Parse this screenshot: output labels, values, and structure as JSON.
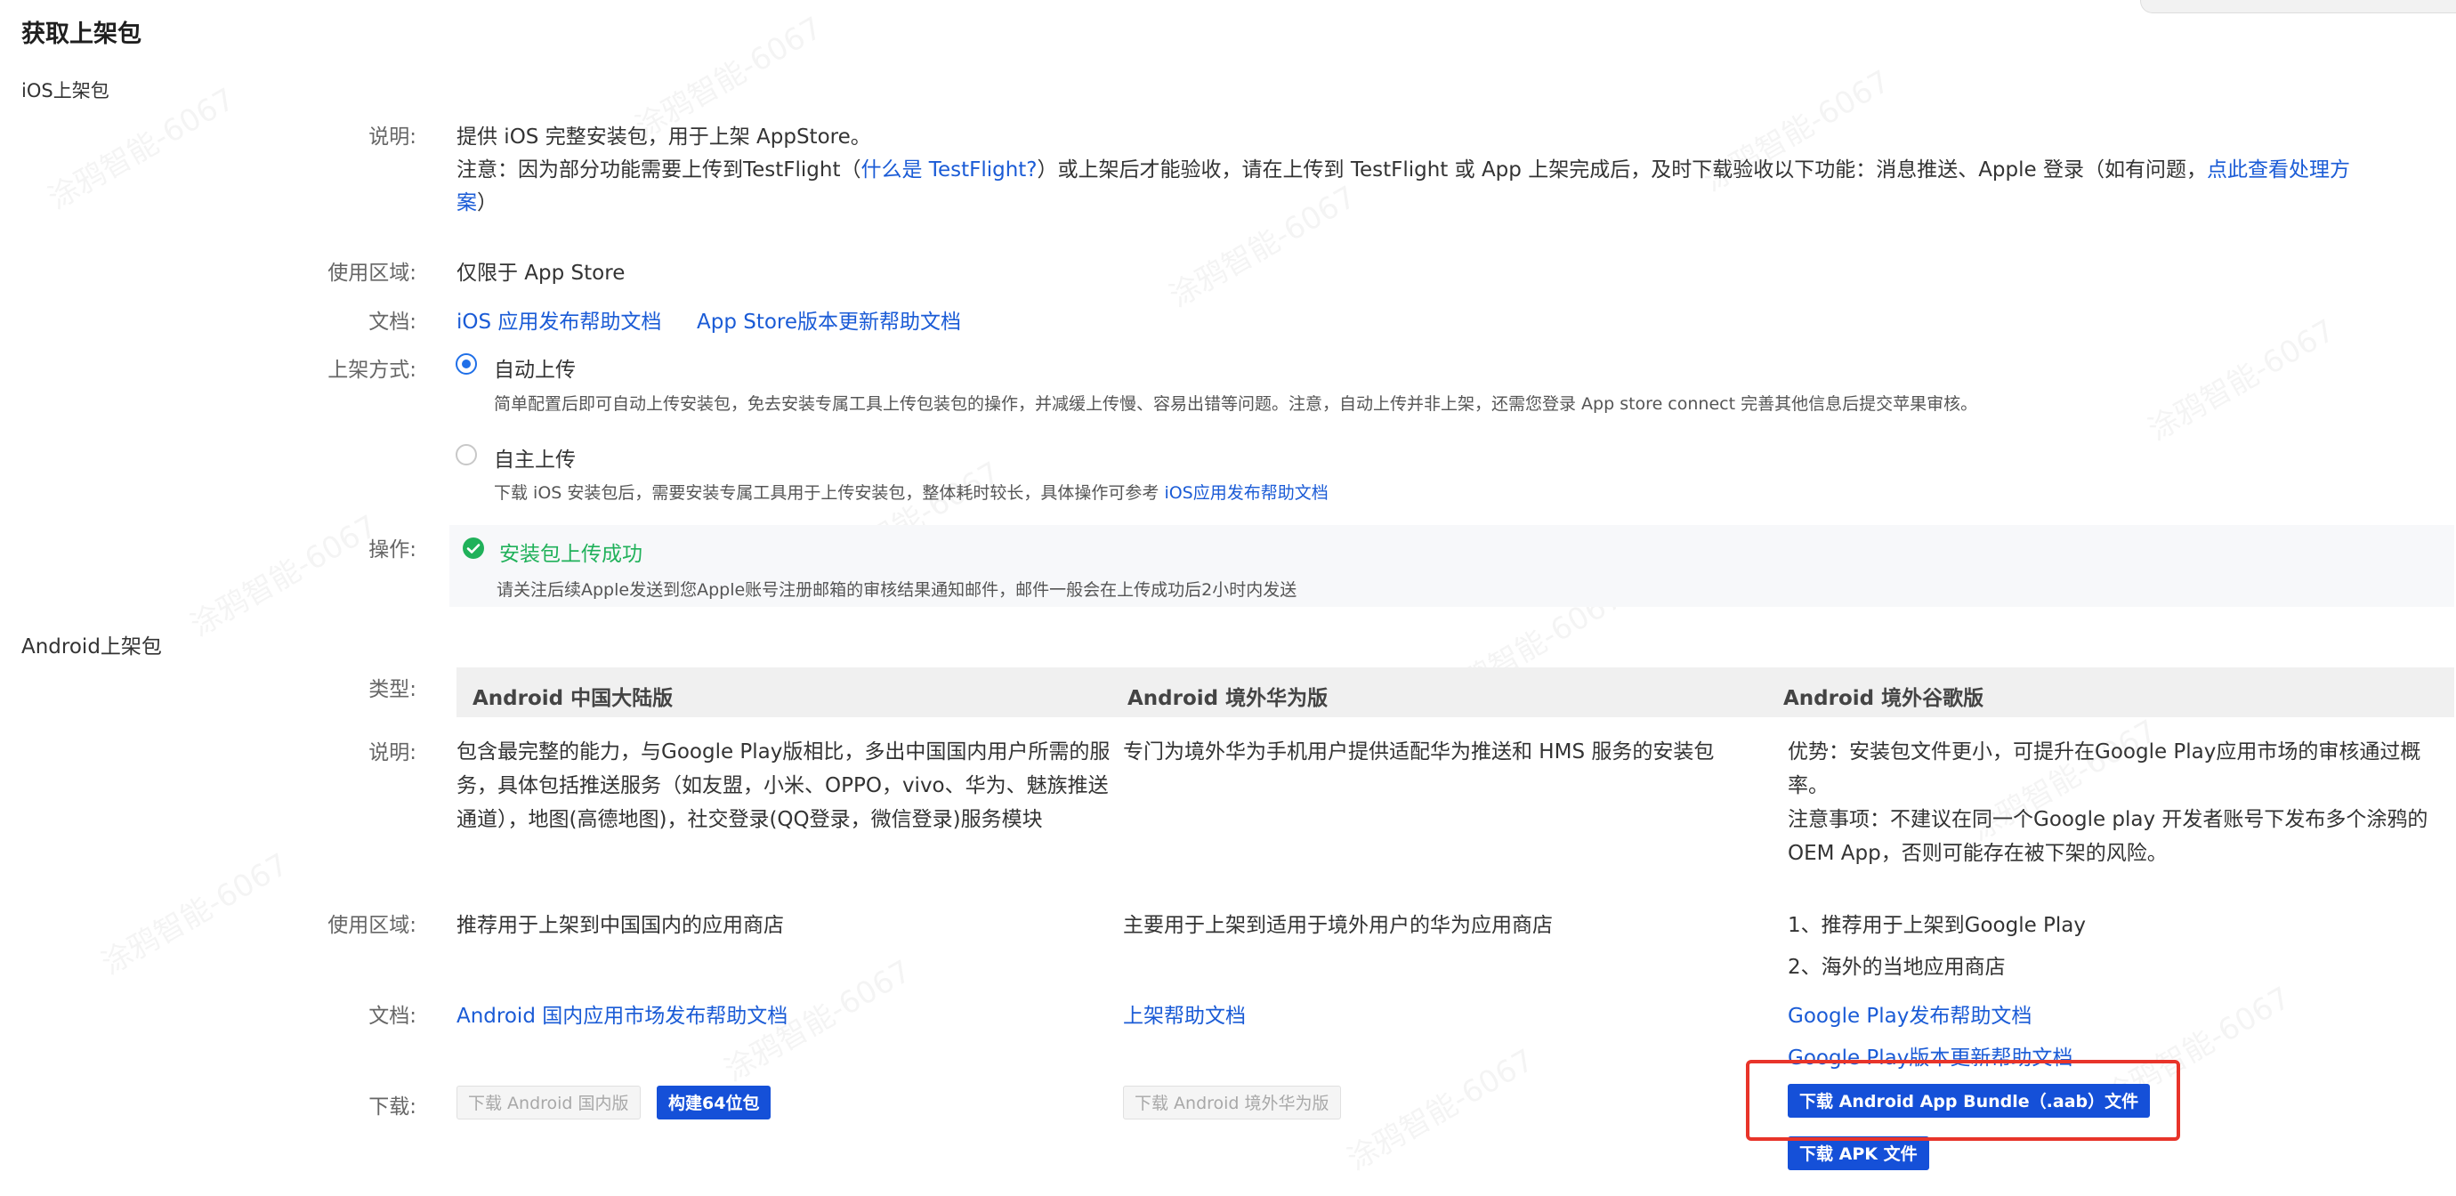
{
  "page": {
    "title": "获取上架包"
  },
  "ios": {
    "section_title": "iOS上架包",
    "desc_label": "说明:",
    "desc_line1": "提供 iOS 完整安装包，用于上架 AppStore。",
    "desc_note_prefix": "注意：因为部分功能需要上传到TestFlight（",
    "desc_note_link1": "什么是 TestFlight?",
    "desc_note_middle": "）或上架后才能验收，请在上传到 TestFlight 或 App 上架完成后，及时下载验收以下功能：消息推送、Apple 登录（如有问题，",
    "desc_note_link2a": "点此查看处理方",
    "desc_note_link2b": "案",
    "desc_note_suffix": "）",
    "region_label": "使用区域:",
    "region_value": "仅限于 App Store",
    "docs_label": "文档:",
    "doc_link1": "iOS 应用发布帮助文档",
    "doc_link2": "App Store版本更新帮助文档",
    "method_label": "上架方式:",
    "auto_upload_label": "自动上传",
    "auto_upload_desc": "简单配置后即可自动上传安装包，免去安装专属工具上传包装包的操作，并减缓上传慢、容易出错等问题。注意，自动上传并非上架，还需您登录 App store connect 完善其他信息后提交苹果审核。",
    "manual_upload_label": "自主上传",
    "manual_upload_desc": "下载 iOS 安装包后，需要安装专属工具用于上传安装包，整体耗时较长，具体操作可参考",
    "manual_upload_link": "iOS应用发布帮助文档",
    "action_label": "操作:",
    "status_title": "安装包上传成功",
    "status_desc": "请关注后续Apple发送到您Apple账号注册邮箱的审核结果通知邮件，邮件一般会在上传成功后2小时内发送"
  },
  "android": {
    "section_title": "Android上架包",
    "type_label": "类型:",
    "desc_label": "说明:",
    "region_label": "使用区域:",
    "docs_label": "文档:",
    "download_label": "下载:",
    "columns": [
      {
        "header": "Android 中国大陆版",
        "desc": "包含最完整的能力，与Google Play版相比，多出中国国内用户所需的服务，具体包括推送服务（如友盟，小米、OPPO，vivo、华为、魅族推送通道），地图(高德地图)，社交登录(QQ登录，微信登录)服务模块",
        "region": "推荐用于上架到中国国内的应用商店",
        "doc1": "Android 国内应用市场发布帮助文档",
        "btn1": "下载 Android 国内版",
        "btn2": "构建64位包"
      },
      {
        "header": "Android 境外华为版",
        "desc": "专门为境外华为手机用户提供适配华为推送和 HMS 服务的安装包",
        "region": "主要用于上架到适用于境外用户的华为应用商店",
        "doc1": "上架帮助文档",
        "btn1": "下载 Android 境外华为版"
      },
      {
        "header": "Android 境外谷歌版",
        "desc_line1": "优势：安装包文件更小，可提升在Google Play应用市场的审核通过概率。",
        "desc_line2": "注意事项：不建议在同一个Google play 开发者账号下发布多个涂鸦的OEM App，否则可能存在被下架的风险。",
        "region_line1": "1、推荐用于上架到Google Play",
        "region_line2": "2、海外的当地应用商店",
        "doc1": "Google Play发布帮助文档",
        "doc2": "Google Play版本更新帮助文档",
        "btn1": "下载 Android App Bundle（.aab）文件",
        "btn2": "下载 APK 文件"
      }
    ]
  },
  "colors": {
    "link": "#1a5bd6",
    "primary": "#1550d8",
    "success": "#20b15a",
    "highlight": "#e8342a"
  },
  "icons": [
    "radio-checked-icon",
    "radio-unchecked-icon",
    "check-circle-icon"
  ]
}
